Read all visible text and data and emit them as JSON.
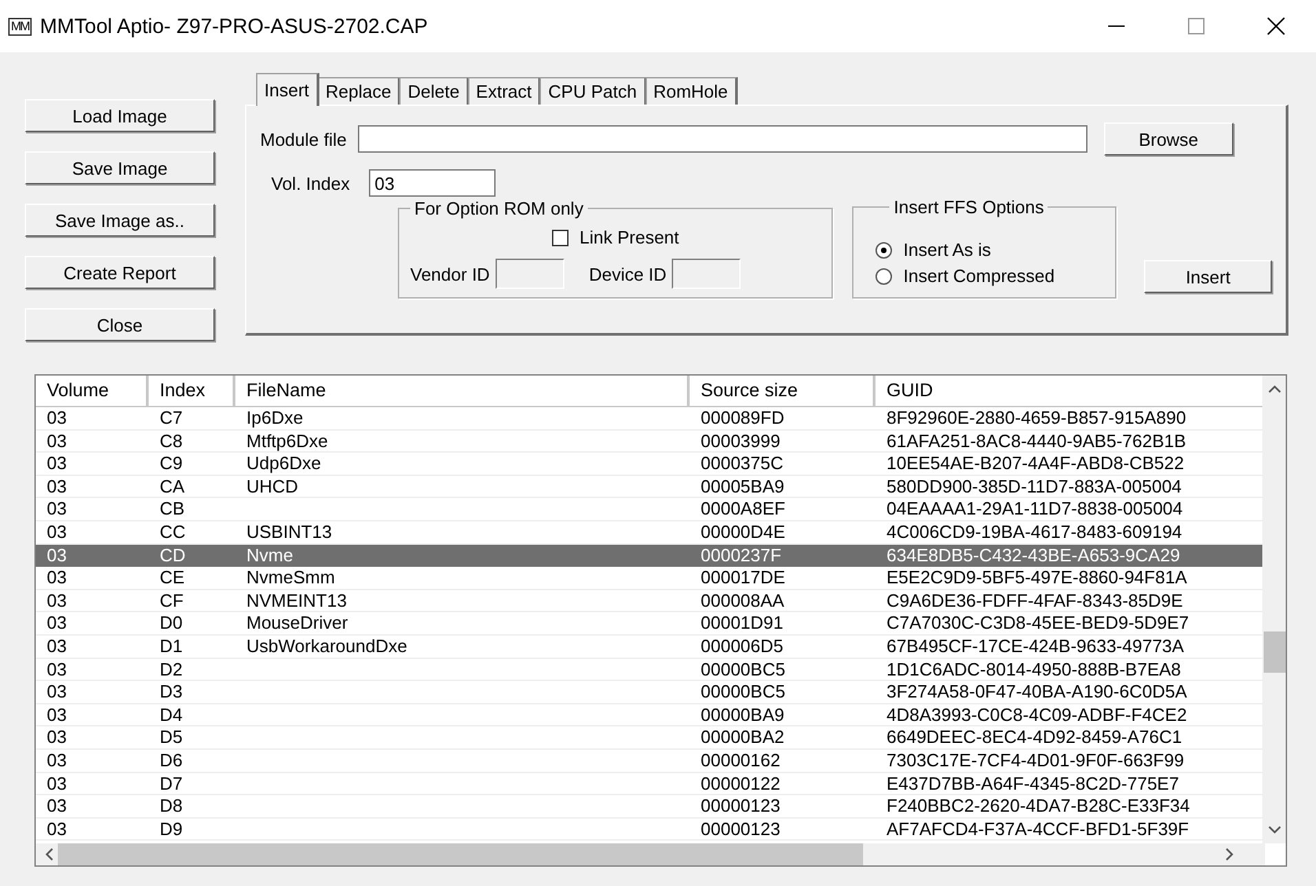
{
  "window": {
    "title": "MMTool Aptio- Z97-PRO-ASUS-2702.CAP",
    "app_icon": "MM"
  },
  "side_buttons": [
    "Load Image",
    "Save Image",
    "Save Image as..",
    "Create Report",
    "Close"
  ],
  "tabs": [
    {
      "label": "Insert",
      "selected": true
    },
    {
      "label": "Replace",
      "selected": false
    },
    {
      "label": "Delete",
      "selected": false
    },
    {
      "label": "Extract",
      "selected": false
    },
    {
      "label": "CPU Patch",
      "selected": false
    },
    {
      "label": "RomHole",
      "selected": false
    }
  ],
  "insert_panel": {
    "module_file_label": "Module file",
    "browse_button": "Browse",
    "vol_index": {
      "label": "Vol. Index",
      "value": "03"
    },
    "option_rom": {
      "title": "For Option ROM only",
      "link_present": {
        "label": "Link Present",
        "checked": false
      },
      "vendor_id_label": "Vendor ID",
      "device_id_label": "Device ID"
    },
    "ffs_options": {
      "title": "Insert FFS Options",
      "options": [
        {
          "label": "Insert As is",
          "selected": true
        },
        {
          "label": "Insert Compressed",
          "selected": false
        }
      ]
    },
    "insert_button": "Insert"
  },
  "table": {
    "columns": [
      "Volume",
      "Index",
      "FileName",
      "Source size",
      "GUID"
    ],
    "rows": [
      {
        "cells": [
          "03",
          "C7",
          "Ip6Dxe",
          "000089FD",
          "8F92960E-2880-4659-B857-915A890"
        ],
        "selected": false
      },
      {
        "cells": [
          "03",
          "C8",
          "Mtftp6Dxe",
          "00003999",
          "61AFA251-8AC8-4440-9AB5-762B1B"
        ],
        "selected": false
      },
      {
        "cells": [
          "03",
          "C9",
          "Udp6Dxe",
          "0000375C",
          "10EE54AE-B207-4A4F-ABD8-CB522"
        ],
        "selected": false
      },
      {
        "cells": [
          "03",
          "CA",
          "UHCD",
          "00005BA9",
          "580DD900-385D-11D7-883A-005004"
        ],
        "selected": false
      },
      {
        "cells": [
          "03",
          "CB",
          "",
          "0000A8EF",
          "04EAAAA1-29A1-11D7-8838-005004"
        ],
        "selected": false
      },
      {
        "cells": [
          "03",
          "CC",
          "USBINT13",
          "00000D4E",
          "4C006CD9-19BA-4617-8483-609194"
        ],
        "selected": false
      },
      {
        "cells": [
          "03",
          "CD",
          "Nvme",
          "0000237F",
          "634E8DB5-C432-43BE-A653-9CA29"
        ],
        "selected": true
      },
      {
        "cells": [
          "03",
          "CE",
          "NvmeSmm",
          "000017DE",
          "E5E2C9D9-5BF5-497E-8860-94F81A"
        ],
        "selected": false
      },
      {
        "cells": [
          "03",
          "CF",
          "NVMEINT13",
          "000008AA",
          "C9A6DE36-FDFF-4FAF-8343-85D9E"
        ],
        "selected": false
      },
      {
        "cells": [
          "03",
          "D0",
          "MouseDriver",
          "00001D91",
          "C7A7030C-C3D8-45EE-BED9-5D9E7"
        ],
        "selected": false
      },
      {
        "cells": [
          "03",
          "D1",
          "UsbWorkaroundDxe",
          "000006D5",
          "67B495CF-17CE-424B-9633-49773A"
        ],
        "selected": false
      },
      {
        "cells": [
          "03",
          "D2",
          "",
          "00000BC5",
          "1D1C6ADC-8014-4950-888B-B7EA8"
        ],
        "selected": false
      },
      {
        "cells": [
          "03",
          "D3",
          "",
          "00000BC5",
          "3F274A58-0F47-40BA-A190-6C0D5A"
        ],
        "selected": false
      },
      {
        "cells": [
          "03",
          "D4",
          "",
          "00000BA9",
          "4D8A3993-C0C8-4C09-ADBF-F4CE2"
        ],
        "selected": false
      },
      {
        "cells": [
          "03",
          "D5",
          "",
          "00000BA2",
          "6649DEEC-8EC4-4D92-8459-A76C1"
        ],
        "selected": false
      },
      {
        "cells": [
          "03",
          "D6",
          "",
          "00000162",
          "7303C17E-7CF4-4D01-9F0F-663F99"
        ],
        "selected": false
      },
      {
        "cells": [
          "03",
          "D7",
          "",
          "00000122",
          "E437D7BB-A64F-4345-8C2D-775E7"
        ],
        "selected": false
      },
      {
        "cells": [
          "03",
          "D8",
          "",
          "00000123",
          "F240BBC2-2620-4DA7-B28C-E33F34"
        ],
        "selected": false
      },
      {
        "cells": [
          "03",
          "D9",
          "",
          "00000123",
          "AF7AFCD4-F37A-4CCF-BFD1-5F39F"
        ],
        "selected": false
      }
    ]
  }
}
